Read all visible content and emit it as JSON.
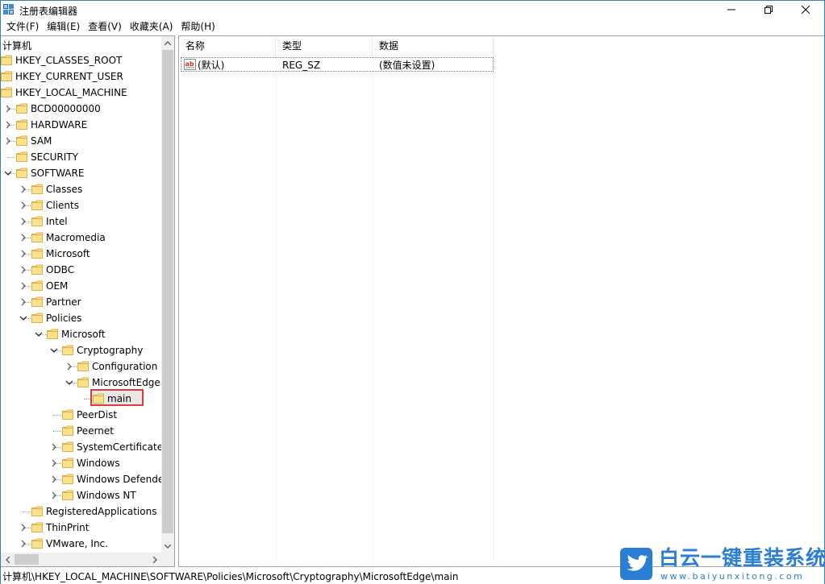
{
  "window": {
    "title": "注册表编辑器"
  },
  "menu": [
    "文件(F)",
    "编辑(E)",
    "查看(V)",
    "收藏夹(A)",
    "帮助(H)"
  ],
  "tree": {
    "root": "计算机",
    "items": [
      {
        "label": "HKEY_CLASSES_ROOT"
      },
      {
        "label": "HKEY_CURRENT_USER"
      },
      {
        "label": "HKEY_LOCAL_MACHINE"
      },
      {
        "label": "BCD00000000"
      },
      {
        "label": "HARDWARE"
      },
      {
        "label": "SAM"
      },
      {
        "label": "SECURITY"
      },
      {
        "label": "SOFTWARE"
      },
      {
        "label": "Classes"
      },
      {
        "label": "Clients"
      },
      {
        "label": "Intel"
      },
      {
        "label": "Macromedia"
      },
      {
        "label": "Microsoft"
      },
      {
        "label": "ODBC"
      },
      {
        "label": "OEM"
      },
      {
        "label": "Partner"
      },
      {
        "label": "Policies"
      },
      {
        "label": "Microsoft"
      },
      {
        "label": "Cryptography"
      },
      {
        "label": "Configuration"
      },
      {
        "label": "MicrosoftEdge"
      },
      {
        "label": "main"
      },
      {
        "label": "PeerDist"
      },
      {
        "label": "Peernet"
      },
      {
        "label": "SystemCertificates"
      },
      {
        "label": "Windows"
      },
      {
        "label": "Windows Defender"
      },
      {
        "label": "Windows NT"
      },
      {
        "label": "RegisteredApplications"
      },
      {
        "label": "ThinPrint"
      },
      {
        "label": "VMware, Inc."
      }
    ]
  },
  "list": {
    "columns": [
      "名称",
      "类型",
      "数据"
    ],
    "rows": [
      {
        "name": "(默认)",
        "type": "REG_SZ",
        "data": "(数值未设置)"
      }
    ]
  },
  "status": "计算机\\HKEY_LOCAL_MACHINE\\SOFTWARE\\Policies\\Microsoft\\Cryptography\\MicrosoftEdge\\main",
  "watermark": {
    "title": "白云一键重装系统",
    "url": "www.baiyunxitong.com"
  },
  "colors": {
    "folder": "#ffe08a",
    "selection_outline": "#e03b3b",
    "watermark": "#2a7fd4"
  }
}
